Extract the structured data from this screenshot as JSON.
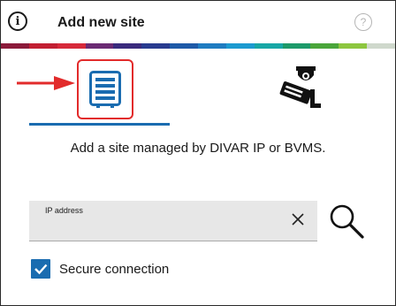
{
  "header": {
    "title": "Add new site",
    "info_icon_glyph": "i",
    "help_icon_glyph": "?"
  },
  "brand_stripe_colors": [
    "#8b1a3a",
    "#c21f32",
    "#d6293a",
    "#6b2a73",
    "#3a2a7d",
    "#283b8f",
    "#1e5aa8",
    "#1f7cc1",
    "#1c9ad0",
    "#18a7a6",
    "#1d9a6a",
    "#4aa63a",
    "#8dc63f",
    "#cfd8cc"
  ],
  "tabs": [
    {
      "name": "divar-bvms-site",
      "icon": "server-list-icon",
      "selected": true
    },
    {
      "name": "camera-site",
      "icon": "security-camera-icon",
      "selected": false
    }
  ],
  "description": "Add a site managed by DIVAR IP or BVMS.",
  "ip_field": {
    "label": "IP address",
    "value": "",
    "clear_icon": "close-icon",
    "search_icon": "search-icon"
  },
  "secure_connection": {
    "label": "Secure connection",
    "checked": true
  },
  "colors": {
    "accent": "#1a6cb0",
    "highlight_box": "#e22b2b",
    "pointer_arrow": "#e22b2b"
  }
}
